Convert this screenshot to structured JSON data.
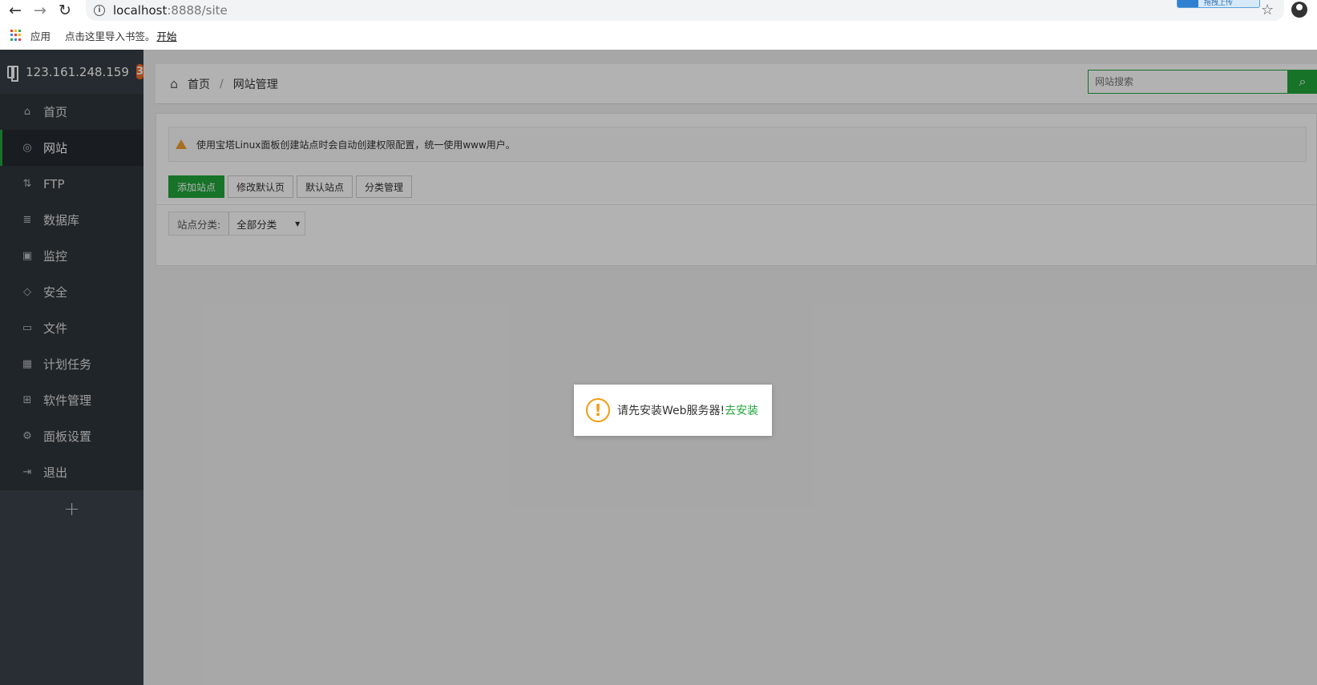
{
  "browser": {
    "url_host": "localhost",
    "url_path": ":8888/site",
    "extension_label": "拖拽上传",
    "bookmarks": {
      "apps_label": "应用",
      "import_text": "点击这里导入书签。",
      "import_link": "开始"
    },
    "apps_icon_colors": [
      "#ea4335",
      "#fbbc05",
      "#34a853",
      "#4285f4",
      "#ea4335",
      "#fbbc05",
      "#34a853",
      "#4285f4",
      "#ea4335"
    ]
  },
  "sidebar": {
    "server_ip": "123.161.248.159",
    "badge_count": "3",
    "items": [
      {
        "label": "首页",
        "icon": "home-icon",
        "glyph": "⌂"
      },
      {
        "label": "网站",
        "icon": "globe-icon",
        "glyph": "◎"
      },
      {
        "label": "FTP",
        "icon": "ftp-icon",
        "glyph": "⇅"
      },
      {
        "label": "数据库",
        "icon": "database-icon",
        "glyph": "≣"
      },
      {
        "label": "监控",
        "icon": "monitor-icon",
        "glyph": "▣"
      },
      {
        "label": "安全",
        "icon": "shield-icon",
        "glyph": "◇"
      },
      {
        "label": "文件",
        "icon": "folder-icon",
        "glyph": "▭"
      },
      {
        "label": "计划任务",
        "icon": "calendar-icon",
        "glyph": "▦"
      },
      {
        "label": "软件管理",
        "icon": "grid-icon",
        "glyph": "⊞"
      },
      {
        "label": "面板设置",
        "icon": "gear-icon",
        "glyph": "⚙"
      },
      {
        "label": "退出",
        "icon": "logout-icon",
        "glyph": "⇥"
      }
    ],
    "add_label": "+"
  },
  "header": {
    "breadcrumb_home": "首页",
    "breadcrumb_sep": "/",
    "breadcrumb_current": "网站管理",
    "search_placeholder": "网站搜索"
  },
  "main": {
    "notice_text": "使用宝塔Linux面板创建站点时会自动创建权限配置，统一使用www用户。",
    "buttons": [
      "添加站点",
      "修改默认页",
      "默认站点",
      "分类管理"
    ],
    "filter_label": "站点分类:",
    "filter_value": "全部分类"
  },
  "dialog": {
    "message": "请先安装Web服务器!",
    "link": "去安装"
  },
  "colors": {
    "accent_green": "#20a53a",
    "badge_orange": "#f36a28",
    "warning_orange": "#f39c12",
    "sidebar_bg": "#3a424a"
  }
}
